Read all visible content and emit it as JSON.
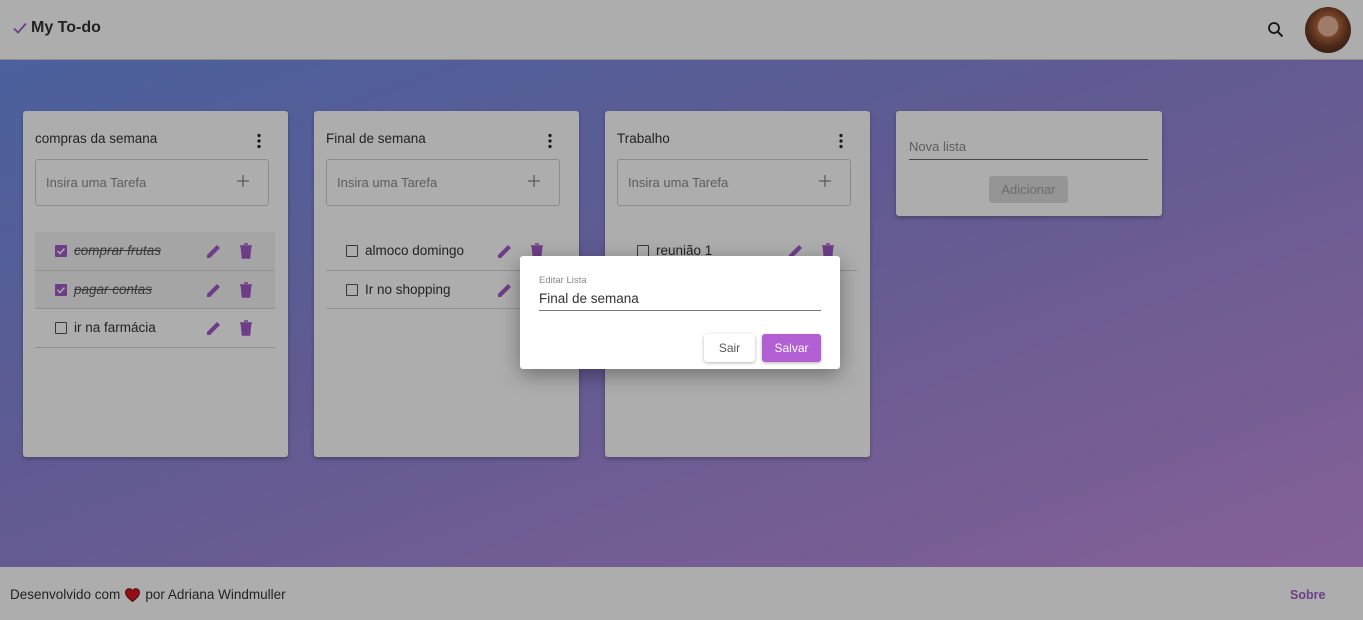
{
  "app": {
    "title": "My To-do"
  },
  "colors": {
    "accent": "#a35bc8",
    "primary_button": "#b15fd2"
  },
  "header": {
    "icons": [
      "check-icon",
      "search-icon",
      "avatar"
    ]
  },
  "lists": [
    {
      "title": "compras da semana",
      "input_placeholder": "Insira uma Tarefa",
      "tasks": [
        {
          "label": "comprar frutas",
          "done": true
        },
        {
          "label": "pagar contas",
          "done": true
        },
        {
          "label": "ir na farmácia",
          "done": false
        }
      ]
    },
    {
      "title": "Final de semana",
      "input_placeholder": "Insira uma Tarefa",
      "tasks": [
        {
          "label": "almoco domingo",
          "done": false
        },
        {
          "label": "Ir no shopping",
          "done": false
        }
      ]
    },
    {
      "title": "Trabalho",
      "input_placeholder": "Insira uma Tarefa",
      "tasks": [
        {
          "label": "reunião 1",
          "done": false
        }
      ]
    }
  ],
  "new_list": {
    "placeholder": "Nova lista",
    "button_label": "Adicionar"
  },
  "dialog": {
    "label": "Editar Lista",
    "value": "Final de semana",
    "cancel_label": "Sair",
    "save_label": "Salvar"
  },
  "footer": {
    "text_before": "Desenvolvido com",
    "text_after": "por Adriana Windmuller",
    "about_label": "Sobre"
  }
}
